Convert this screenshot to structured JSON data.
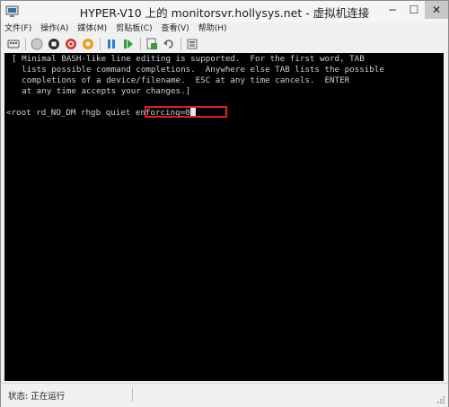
{
  "window": {
    "title": "HYPER-V10 上的 monitorsvr.hollysys.net - 虚拟机连接",
    "minimize": "─",
    "maximize": "☐",
    "close": "✕"
  },
  "menu": [
    "文件(F)",
    "操作(A)",
    "媒体(M)",
    "剪贴板(C)",
    "查看(V)",
    "帮助(H)"
  ],
  "toolbar": {
    "icons": [
      "ctrl-alt-del-icon",
      "start-icon",
      "turnoff-icon",
      "shutdown-icon",
      "save-icon",
      "pause-icon",
      "reset-icon",
      "checkpoint-icon",
      "revert-icon",
      "enhanced-session-icon"
    ]
  },
  "terminal": {
    "lines": [
      "[ Minimal BASH-like line editing is supported.  For the first word, TAB",
      "  lists possible command completions.  Anywhere else TAB lists the possible",
      "  completions of a device/filename.  ESC at any time cancels.  ENTER",
      "  at any time accepts your changes.]",
      "",
      "<root rd_NO_DM rhgb quiet enforcing=0"
    ],
    "highlighted_text": "enforcing=0"
  },
  "status": {
    "text": "状态: 正在运行"
  },
  "colors": {
    "terminal_bg": "#000000",
    "terminal_fg": "#cfcfcf",
    "highlight_border": "#e02020"
  }
}
